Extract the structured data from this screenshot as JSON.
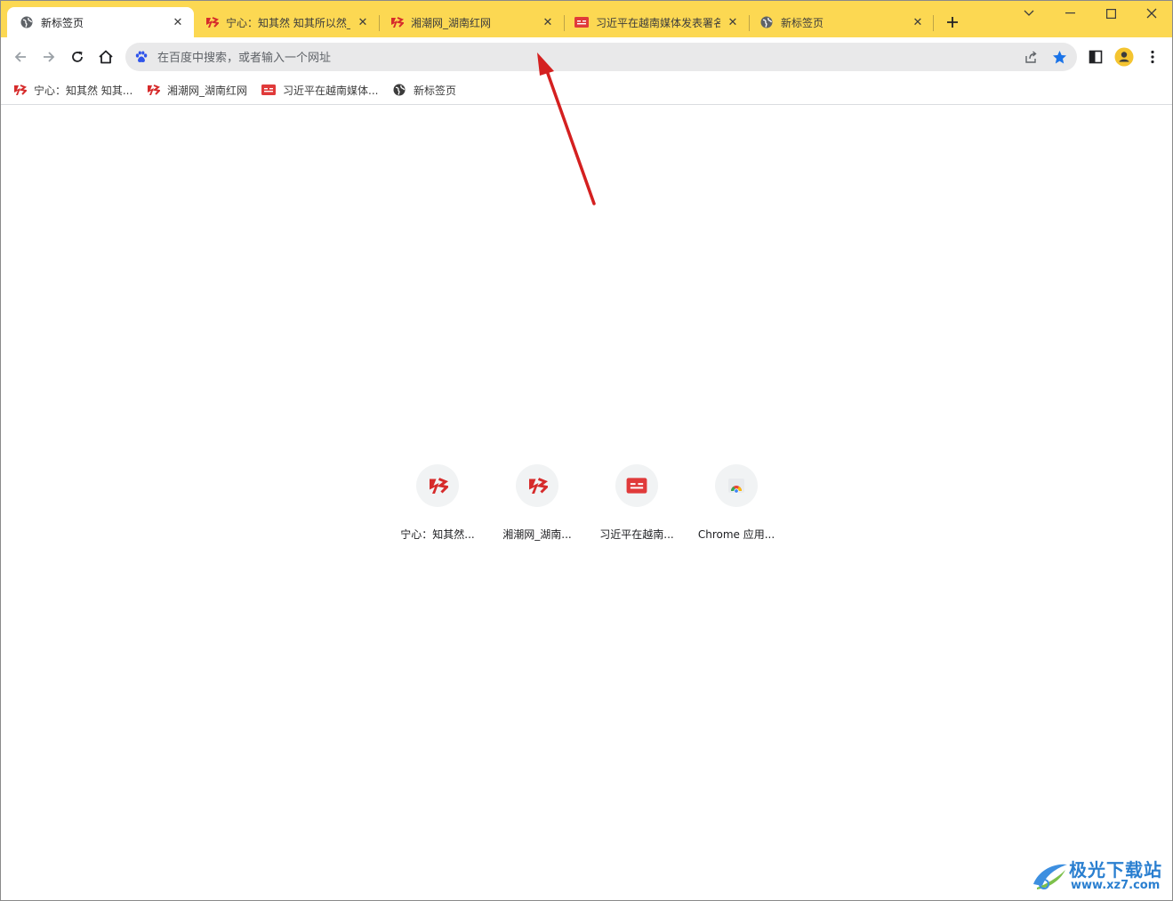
{
  "tabs": [
    {
      "title": "新标签页",
      "icon": "globe-icon",
      "active": true
    },
    {
      "title": "宁心：知其然 知其所以然_",
      "icon": "xiangchao-logo-icon",
      "active": false
    },
    {
      "title": "湘潮网_湖南红网",
      "icon": "xiangchao-logo-icon",
      "active": false
    },
    {
      "title": "习近平在越南媒体发表署名",
      "icon": "toutiao-logo-icon",
      "active": false
    },
    {
      "title": "新标签页",
      "icon": "globe-icon",
      "active": false
    }
  ],
  "omnibox": {
    "placeholder": "在百度中搜索，或者输入一个网址",
    "search_engine_icon": "baidu-icon"
  },
  "bookmarks": [
    {
      "label": "宁心：知其然 知其...",
      "icon": "xiangchao-logo-icon"
    },
    {
      "label": "湘潮网_湖南红网",
      "icon": "xiangchao-logo-icon"
    },
    {
      "label": "习近平在越南媒体...",
      "icon": "toutiao-logo-icon"
    },
    {
      "label": "新标签页",
      "icon": "globe-icon"
    }
  ],
  "shortcuts": [
    {
      "label": "宁心：知其然...",
      "icon": "xiangchao-logo-icon"
    },
    {
      "label": "湘潮网_湖南...",
      "icon": "xiangchao-logo-icon"
    },
    {
      "label": "习近平在越南...",
      "icon": "toutiao-logo-icon"
    },
    {
      "label": "Chrome 应用...",
      "icon": "chrome-apps-icon"
    }
  ],
  "watermark": {
    "brand": "极光下载站",
    "url": "www.xz7.com"
  },
  "colors": {
    "tab_strip": "#fcd852",
    "omnibox": "#e9e9ea",
    "accent_star": "#1a73e8",
    "logo_red": "#d62b2b",
    "annotation_arrow": "#d42020"
  }
}
